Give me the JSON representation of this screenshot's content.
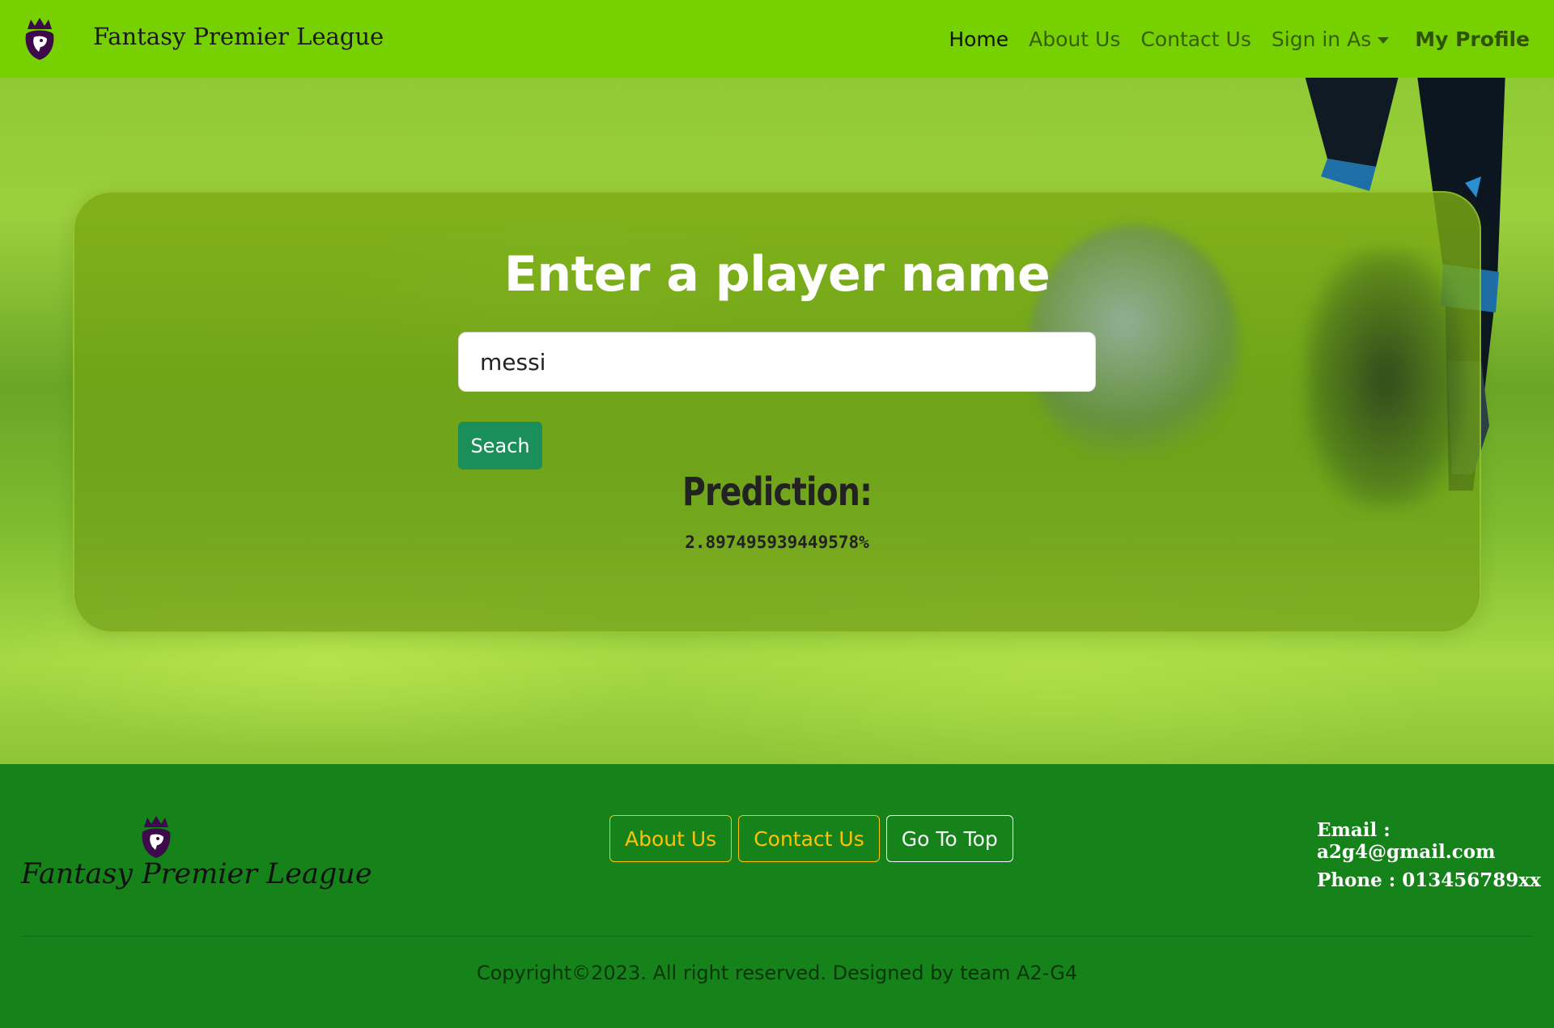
{
  "colors": {
    "navbar_bg": "#77d100",
    "footer_bg": "#15831a",
    "search_button_bg": "#1b8f5a",
    "footer_outline_warning": "#ffc107",
    "footer_outline_light": "#f8f9fa",
    "logo_purple": "#3d0a4a"
  },
  "navbar": {
    "logo_icon": "premier-league-lion-icon",
    "brand": "Fantasy Premier League",
    "links": {
      "home": "Home",
      "about": "About Us",
      "contact": "Contact Us",
      "sign_in": "Sign in As",
      "profile": "My Profile"
    }
  },
  "search": {
    "title": "Enter a player name",
    "input_value": "messi",
    "button_label": "Seach"
  },
  "prediction": {
    "label": "Prediction:",
    "value": "2.897495939449578%"
  },
  "footer": {
    "logo_icon": "premier-league-lion-icon",
    "brand": "Fantasy Premier League",
    "buttons": {
      "about": "About Us",
      "contact": "Contact Us",
      "top": "Go To Top"
    },
    "email": "Email : a2g4@gmail.com",
    "phone": "Phone : 013456789xx",
    "copyright": "Copyright©2023. All right reserved. Designed by team A2-G4"
  }
}
